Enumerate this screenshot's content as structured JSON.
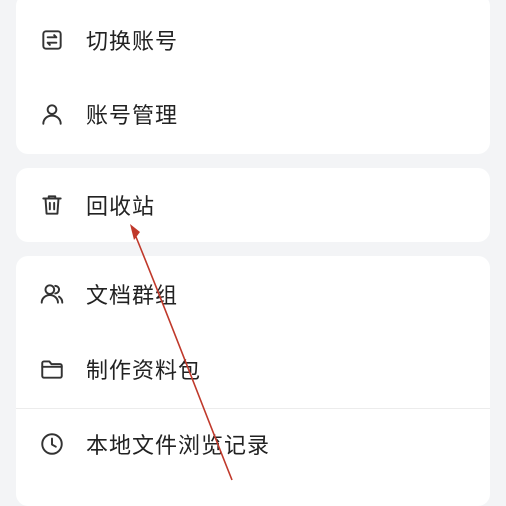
{
  "menu_groups": [
    {
      "items": [
        {
          "label": "切换账号",
          "icon": "switch-account-icon"
        },
        {
          "label": "账号管理",
          "icon": "user-icon"
        }
      ]
    },
    {
      "items": [
        {
          "label": "回收站",
          "icon": "trash-icon"
        }
      ]
    },
    {
      "items": [
        {
          "label": "文档群组",
          "icon": "group-icon"
        },
        {
          "label": "制作资料包",
          "icon": "folder-icon"
        },
        {
          "label": "本地文件浏览记录",
          "icon": "clock-icon"
        }
      ]
    }
  ],
  "colors": {
    "background": "#f3f4f6",
    "card": "#ffffff",
    "text": "#222222",
    "annotation_arrow": "#c0392b"
  }
}
